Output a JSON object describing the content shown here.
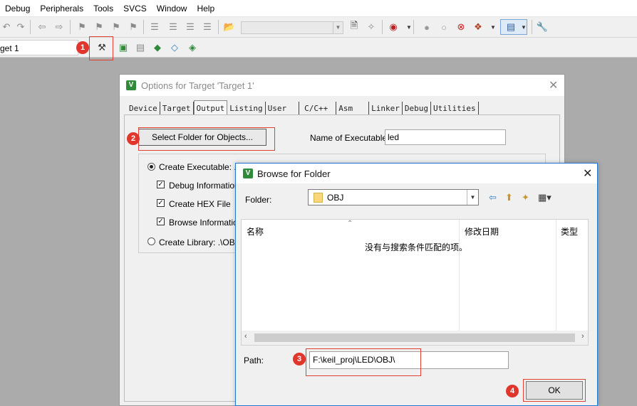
{
  "menu": [
    "Debug",
    "Peripherals",
    "Tools",
    "SVCS",
    "Window",
    "Help"
  ],
  "target": {
    "label": "get 1"
  },
  "annotations": [
    "1",
    "2",
    "3",
    "4"
  ],
  "options_dialog": {
    "title": "Options for Target 'Target 1'",
    "tabs": [
      "Device",
      "Target",
      "Output",
      "Listing",
      "User",
      "C/C++",
      "Asm",
      "Linker",
      "Debug",
      "Utilities"
    ],
    "active_tab": "Output",
    "select_folder_button": "Select Folder for Objects...",
    "name_of_executable_label": "Name of Executable:",
    "name_of_executable_value": "led",
    "create_executable_label": "Create Executable:  .\\",
    "debug_information_label": "Debug Information",
    "create_hex_label": "Create HEX File",
    "browse_information_label": "Browse Information",
    "create_library_label": "Create Library:  .\\OBJ\\"
  },
  "browse_dialog": {
    "title": "Browse for Folder",
    "folder_label": "Folder:",
    "folder_value": "OBJ",
    "columns": [
      "名称",
      "修改日期",
      "类型"
    ],
    "empty_message": "没有与搜索条件匹配的项。",
    "path_label": "Path:",
    "path_value": "F:\\keil_proj\\LED\\OBJ\\",
    "ok_label": "OK"
  },
  "colors": {
    "accent": "#1e78d0",
    "annotation": "#e0362b",
    "logo": "#2f8a3a"
  }
}
